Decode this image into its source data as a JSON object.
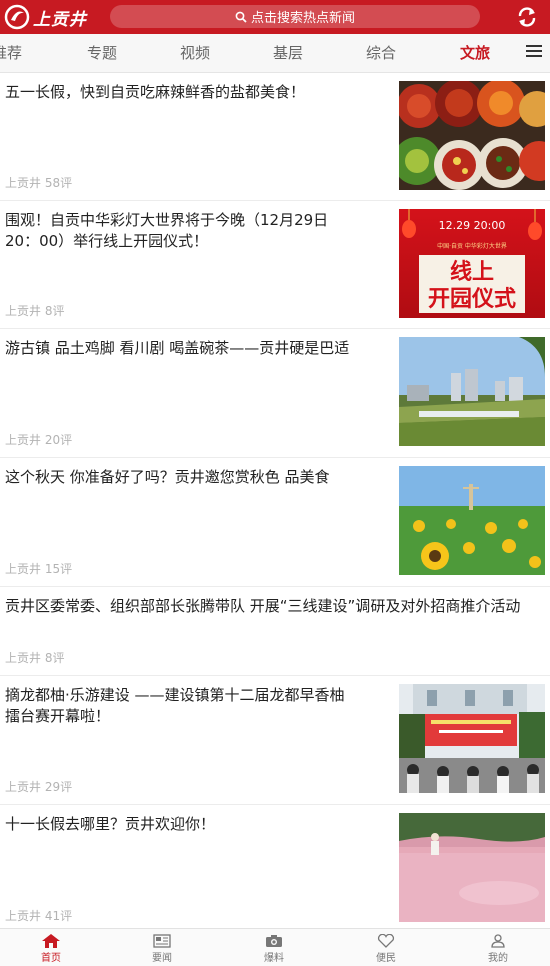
{
  "header": {
    "logo_text": "上贡井",
    "search_placeholder": "点击搜索热点新闻",
    "accent_color": "#c71a22",
    "icons": [
      "logo-icon",
      "search-icon",
      "refresh-icon"
    ]
  },
  "tabs": [
    {
      "label": "推荐"
    },
    {
      "label": "专题"
    },
    {
      "label": "视频"
    },
    {
      "label": "基层"
    },
    {
      "label": "综合"
    },
    {
      "label": "文旅",
      "active": true
    }
  ],
  "menu_icon": "menu-icon",
  "news": [
    {
      "title": "五一长假，快到自贡吃麻辣鲜香的盐都美食！",
      "meta": "上贡井 58评",
      "thumb": "food-dishes"
    },
    {
      "title": "围观！自贡中华彩灯大世界将于今晚（12月29日20：00）举行线上开园仪式！",
      "meta": "上贡井 8评",
      "thumb": "lantern-poster",
      "thumb_text": {
        "time": "12.29 20:00",
        "line1": "线上",
        "line2": "开园仪式",
        "small": "中国·自贡 中华彩灯大世界"
      }
    },
    {
      "title": "游古镇 品土鸡脚 看川剧 喝盖碗茶——贡井硬是巴适",
      "meta": "上贡井 20评",
      "thumb": "river-town"
    },
    {
      "title": "这个秋天 你准备好了吗？贡井邀您赏秋色 品美食",
      "meta": "上贡井 15评",
      "thumb": "sunflower-field"
    },
    {
      "title": "贡井区委常委、组织部部长张腾带队 开展“三线建设”调研及对外招商推介活动",
      "meta": "上贡井 8评",
      "thumb": null
    },
    {
      "title": "摘龙都柚·乐游建设 ——建设镇第十二届龙都早香柚擂台赛开幕啦！",
      "meta": "上贡井 29评",
      "thumb": "stage-event"
    },
    {
      "title": "十一长假去哪里？贡井欢迎你！",
      "meta": "上贡井 41评",
      "thumb": "pink-grass"
    }
  ],
  "bottom_nav": [
    {
      "label": "首页",
      "icon": "home-icon",
      "active": true
    },
    {
      "label": "要闻",
      "icon": "newspaper-icon"
    },
    {
      "label": "爆料",
      "icon": "camera-icon"
    },
    {
      "label": "便民",
      "icon": "heart-icon"
    },
    {
      "label": "我的",
      "icon": "user-icon"
    }
  ]
}
